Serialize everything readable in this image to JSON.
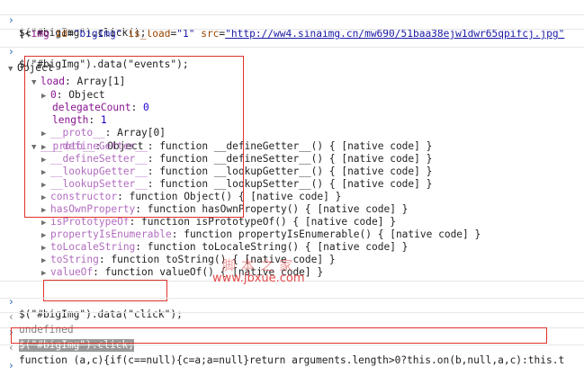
{
  "console": {
    "cmd1": "$(\"#bigImg\").click();",
    "out1_open": "[<",
    "out1_tag": "img",
    "out1_attr1": "id",
    "out1_val1": "\"bigImg\"",
    "out1_attr2": "is_load",
    "out1_val2": "\"1\"",
    "out1_attr3": "src",
    "out1_val3": "\"http://ww4.sinaimg.cn/mw690/51baa38ejw1dwr65qpifcj.jpg\"",
    "cmd2": "$(\"#bigImg\").data(\"events\");",
    "tree": {
      "root": "Object",
      "load_key": "load",
      "load_val": "Array[1]",
      "item0_key": "0",
      "item0_val": "Object",
      "dc_key": "delegateCount",
      "dc_val": "0",
      "len_key": "length",
      "len_val": "1",
      "proto1_key": "__proto__",
      "proto1_val": "Array[0]",
      "proto2_key": "__proto__",
      "proto2_val": "Object",
      "members": [
        {
          "key": "__defineGetter__",
          "val": "function __defineGetter__() { [native code] }"
        },
        {
          "key": "__defineSetter__",
          "val": "function __defineSetter__() { [native code] }"
        },
        {
          "key": "__lookupGetter__",
          "val": "function __lookupGetter__() { [native code] }"
        },
        {
          "key": "__lookupSetter__",
          "val": "function __lookupSetter__() { [native code] }"
        },
        {
          "key": "constructor",
          "val": "function Object() { [native code] }"
        },
        {
          "key": "hasOwnProperty",
          "val": "function hasOwnProperty() { [native code] }"
        },
        {
          "key": "isPrototypeOf",
          "val": "function isPrototypeOf() { [native code] }"
        },
        {
          "key": "propertyIsEnumerable",
          "val": "function propertyIsEnumerable() { [native code] }"
        },
        {
          "key": "toLocaleString",
          "val": "function toLocaleString() { [native code] }"
        },
        {
          "key": "toString",
          "val": "function toString() { [native code] }"
        },
        {
          "key": "valueOf",
          "val": "function valueOf() { [native code] }"
        }
      ]
    },
    "cmd3": "$(\"#bigImg\").data(\"click\");",
    "out3": "undefined",
    "cmd4": "$(\"#bigImg\").click;",
    "out4": "function (a,c){if(c==null){c=a;a=null}return arguments.length>0?this.on(b,null,a,c):this.t"
  },
  "watermark": {
    "cn": "脚本之家",
    "url": "www.jbxue.com"
  }
}
